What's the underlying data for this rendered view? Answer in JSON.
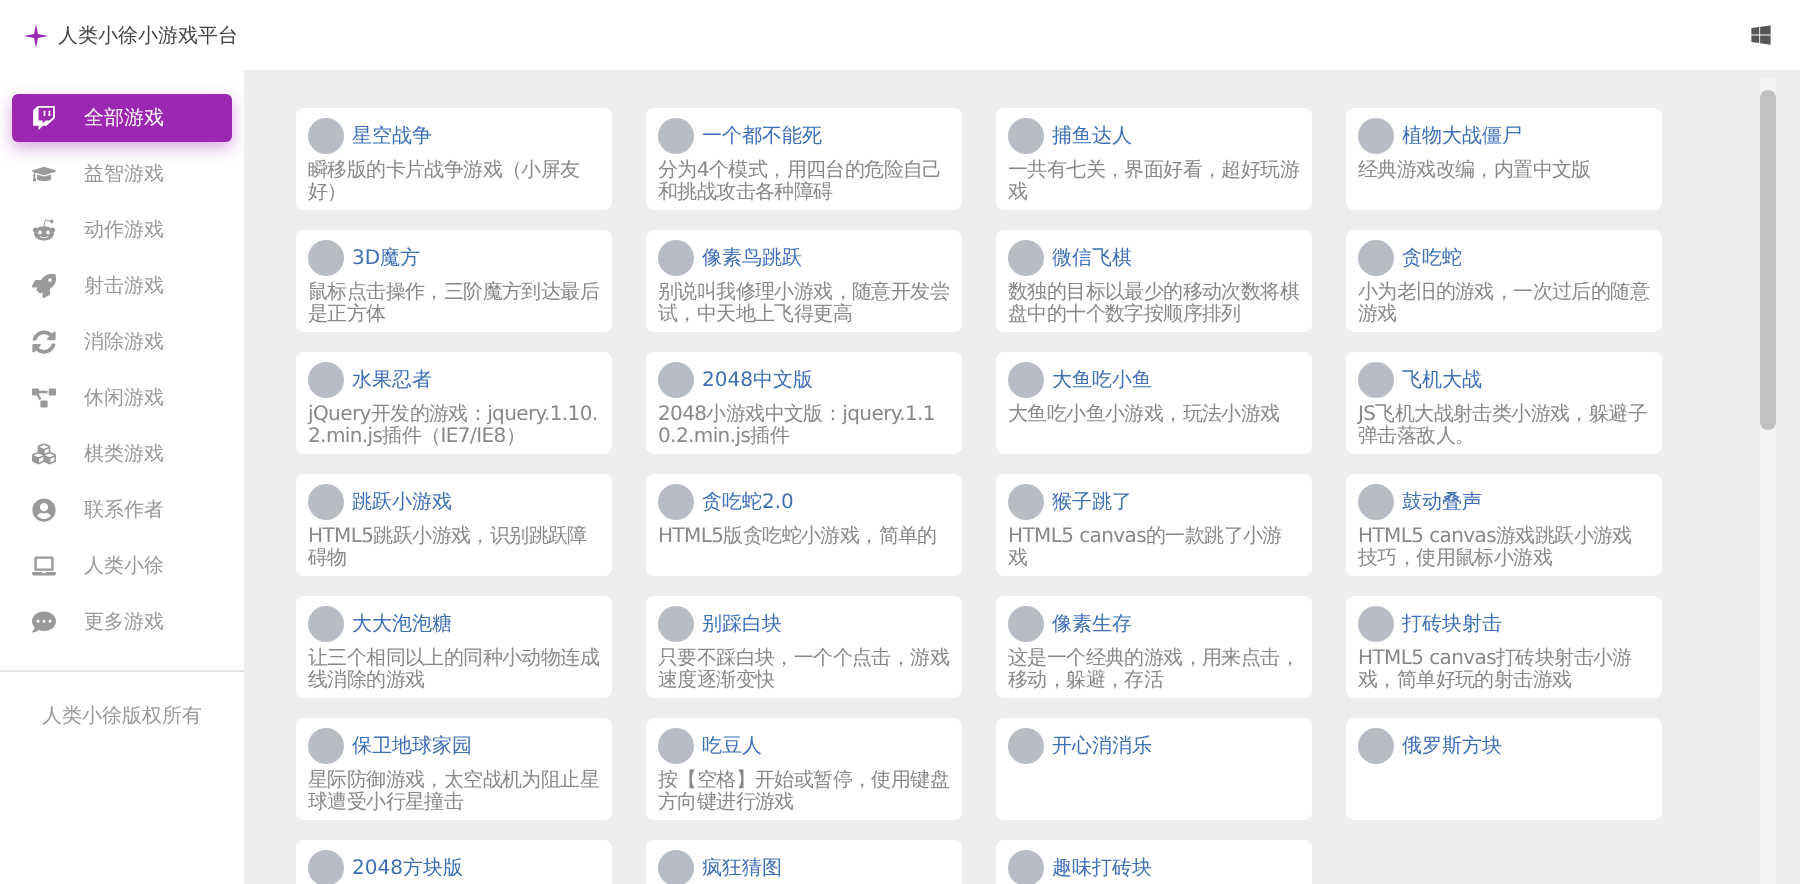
{
  "header": {
    "title": "人类小徐小游戏平台"
  },
  "sidebar": {
    "items": [
      {
        "label": "全部游戏",
        "selected": true
      },
      {
        "label": "益智游戏",
        "selected": false
      },
      {
        "label": "动作游戏",
        "selected": false
      },
      {
        "label": "射击游戏",
        "selected": false
      },
      {
        "label": "消除游戏",
        "selected": false
      },
      {
        "label": "休闲游戏",
        "selected": false
      },
      {
        "label": "棋类游戏",
        "selected": false
      },
      {
        "label": "联系作者",
        "selected": false
      },
      {
        "label": "人类小徐",
        "selected": false
      },
      {
        "label": "更多游戏",
        "selected": false
      }
    ],
    "footer": "人类小徐版权所有"
  },
  "games": [
    {
      "title": "星空战争",
      "description": "瞬移版的卡片战争游戏（小屏友好）"
    },
    {
      "title": "一个都不能死",
      "description": "分为4个模式，用四台的危险自己和挑战攻击各种障碍"
    },
    {
      "title": "捕鱼达人",
      "description": "一共有七关，界面好看，超好玩游戏"
    },
    {
      "title": "植物大战僵尸",
      "description": "经典游戏改编，内置中文版"
    },
    {
      "title": "3D魔方",
      "description": "鼠标点击操作，三阶魔方到达最后是正方体"
    },
    {
      "title": "像素鸟跳跃",
      "description": "别说叫我修理小游戏，随意开发尝试，中天地上飞得更高"
    },
    {
      "title": "微信飞棋",
      "description": "数独的目标以最少的移动次数将棋盘中的十个数字按顺序排列"
    },
    {
      "title": "贪吃蛇",
      "description": "小为老旧的游戏，一次过后的随意游戏"
    },
    {
      "title": "水果忍者",
      "description": "jQuery开发的游戏：jquery.1.10.2.min.js插件（IE7/IE8）"
    },
    {
      "title": "2048中文版",
      "description": "2048小游戏中文版：jquery.1.10.2.min.js插件"
    },
    {
      "title": "大鱼吃小鱼",
      "description": "大鱼吃小鱼小游戏，玩法小游戏"
    },
    {
      "title": "飞机大战",
      "description": "JS飞机大战射击类小游戏，躲避子弹击落敌人。"
    },
    {
      "title": "跳跃小游戏",
      "description": "HTML5跳跃小游戏，识别跳跃障碍物"
    },
    {
      "title": "贪吃蛇2.0",
      "description": "HTML5版贪吃蛇小游戏，简单的"
    },
    {
      "title": "猴子跳了",
      "description": "HTML5 canvas的一款跳了小游戏"
    },
    {
      "title": "鼓动叠声",
      "description": "HTML5 canvas游戏跳跃小游戏技巧，使用鼠标小游戏"
    },
    {
      "title": "大大泡泡糖",
      "description": "让三个相同以上的同种小动物连成线消除的游戏"
    },
    {
      "title": "别踩白块",
      "description": "只要不踩白块，一个个点击，游戏速度逐渐变快"
    },
    {
      "title": "像素生存",
      "description": "这是一个经典的游戏，用来点击，移动，躲避，存活"
    },
    {
      "title": "打砖块射击",
      "description": "HTML5 canvas打砖块射击小游戏，简单好玩的射击游戏"
    },
    {
      "title": "保卫地球家园",
      "description": "星际防御游戏，太空战机为阻止星球遭受小行星撞击"
    },
    {
      "title": "吃豆人",
      "description": "按【空格】开始或暂停，使用键盘方向键进行游戏"
    },
    {
      "title": "开心消消乐"
    },
    {
      "title": "俄罗斯方块"
    },
    {
      "title": "2048方块版"
    },
    {
      "title": "疯狂猜图"
    },
    {
      "title": "趣味打砖块"
    }
  ]
}
